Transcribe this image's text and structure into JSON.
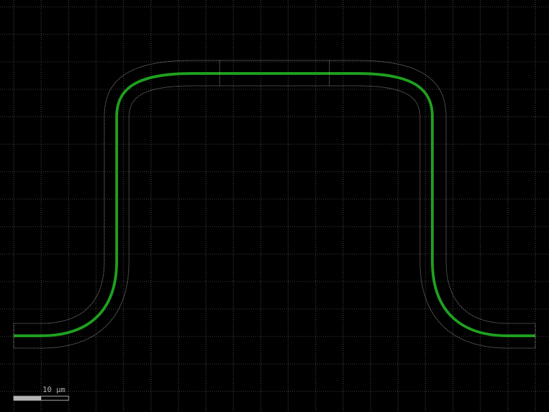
{
  "view": {
    "background_color": "#000000",
    "grid_color": "#8a8a8a"
  },
  "waveguide": {
    "core_color": "#1fa01f",
    "cladding_outline_color": "#b4b4b4"
  },
  "scale_bar": {
    "label": "10 µm",
    "bar_color": "#b4b4b4",
    "label_color": "#b4b4b4"
  }
}
